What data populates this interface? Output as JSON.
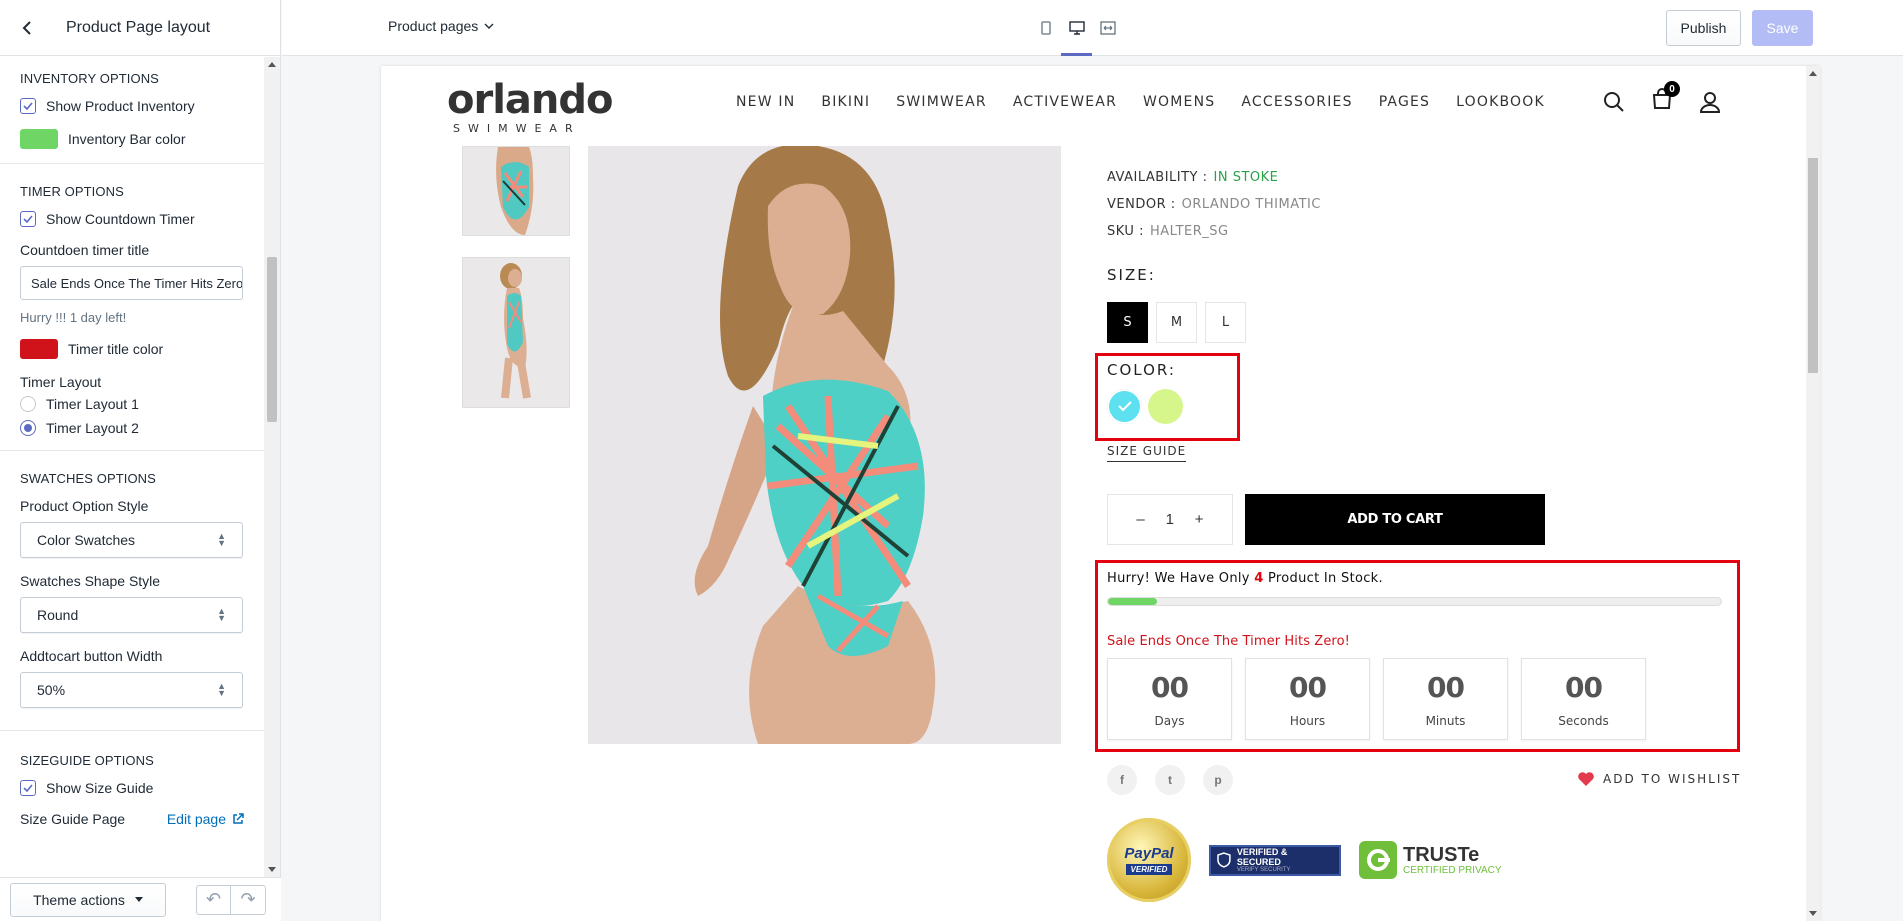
{
  "sidebar": {
    "title": "Product Page layout",
    "inventory": {
      "section_title": "INVENTORY OPTIONS",
      "show_label": "Show Product Inventory",
      "bar_color_label": "Inventory Bar color",
      "bar_color": "#6fd665"
    },
    "timer": {
      "section_title": "TIMER OPTIONS",
      "show_label": "Show Countdown Timer",
      "title_label": "Countdoen timer title",
      "title_value": "Sale Ends Once The Timer Hits Zero!",
      "hint": "Hurry !!! 1 day left!",
      "title_color_label": "Timer title color",
      "title_color": "#d0131b",
      "layout_label": "Timer Layout",
      "layout1": "Timer Layout 1",
      "layout2": "Timer Layout 2"
    },
    "swatches": {
      "section_title": "SWATCHES OPTIONS",
      "option_style_label": "Product Option Style",
      "option_style_value": "Color Swatches",
      "shape_label": "Swatches Shape Style",
      "shape_value": "Round",
      "width_label": "Addtocart button Width",
      "width_value": "50%"
    },
    "sizeguide": {
      "section_title": "SIZEGUIDE OPTIONS",
      "show_label": "Show Size Guide",
      "page_label": "Size Guide Page",
      "edit_link": "Edit page"
    },
    "footer": {
      "theme_actions": "Theme actions"
    }
  },
  "topbar": {
    "page_select": "Product pages",
    "publish": "Publish",
    "save": "Save"
  },
  "store": {
    "logo_main": "orlando",
    "logo_sub": "SWIMWEAR",
    "nav": [
      "NEW IN",
      "BIKINI",
      "SWIMWEAR",
      "ACTIVEWEAR",
      "WOMENS",
      "ACCESSORIES",
      "PAGES",
      "LOOKBOOK"
    ],
    "cart_count": "0"
  },
  "product": {
    "availability_label": "AVAILABILITY :",
    "availability_value": "IN STOKE",
    "vendor_label": "VENDOR :",
    "vendor_value": "ORLANDO THIMATIC",
    "sku_label": "SKU :",
    "sku_value": "HALTER_SG",
    "size_title": "SIZE:",
    "sizes": [
      "S",
      "M",
      "L"
    ],
    "color_title": "COLOR:",
    "colors": [
      "#5de0ef",
      "#d6f58a"
    ],
    "size_guide": "SIZE GUIDE",
    "qty_minus": "–",
    "qty_value": "1",
    "qty_plus": "+",
    "add_to_cart": "ADD TO CART",
    "hurry_prefix": "Hurry! We Have Only",
    "stock_count": "4",
    "hurry_suffix": "Product In Stock.",
    "inventory_fill_fraction": 0.08,
    "sale_title": "Sale Ends Once The Timer Hits Zero!",
    "timer": [
      {
        "value": "00",
        "label": "Days"
      },
      {
        "value": "00",
        "label": "Hours"
      },
      {
        "value": "00",
        "label": "Minuts"
      },
      {
        "value": "00",
        "label": "Seconds"
      }
    ],
    "socials": [
      "f",
      "t",
      "p"
    ],
    "wishlist": "ADD TO WISHLIST",
    "badges": {
      "paypal_main": "PayPal",
      "paypal_sub": "VERIFIED",
      "verified_main": "VERIFIED & SECURED",
      "verified_sub": "VERIFY SECURITY",
      "truste_main": "TRUSTe",
      "truste_sub": "CERTIFIED PRIVACY"
    }
  }
}
